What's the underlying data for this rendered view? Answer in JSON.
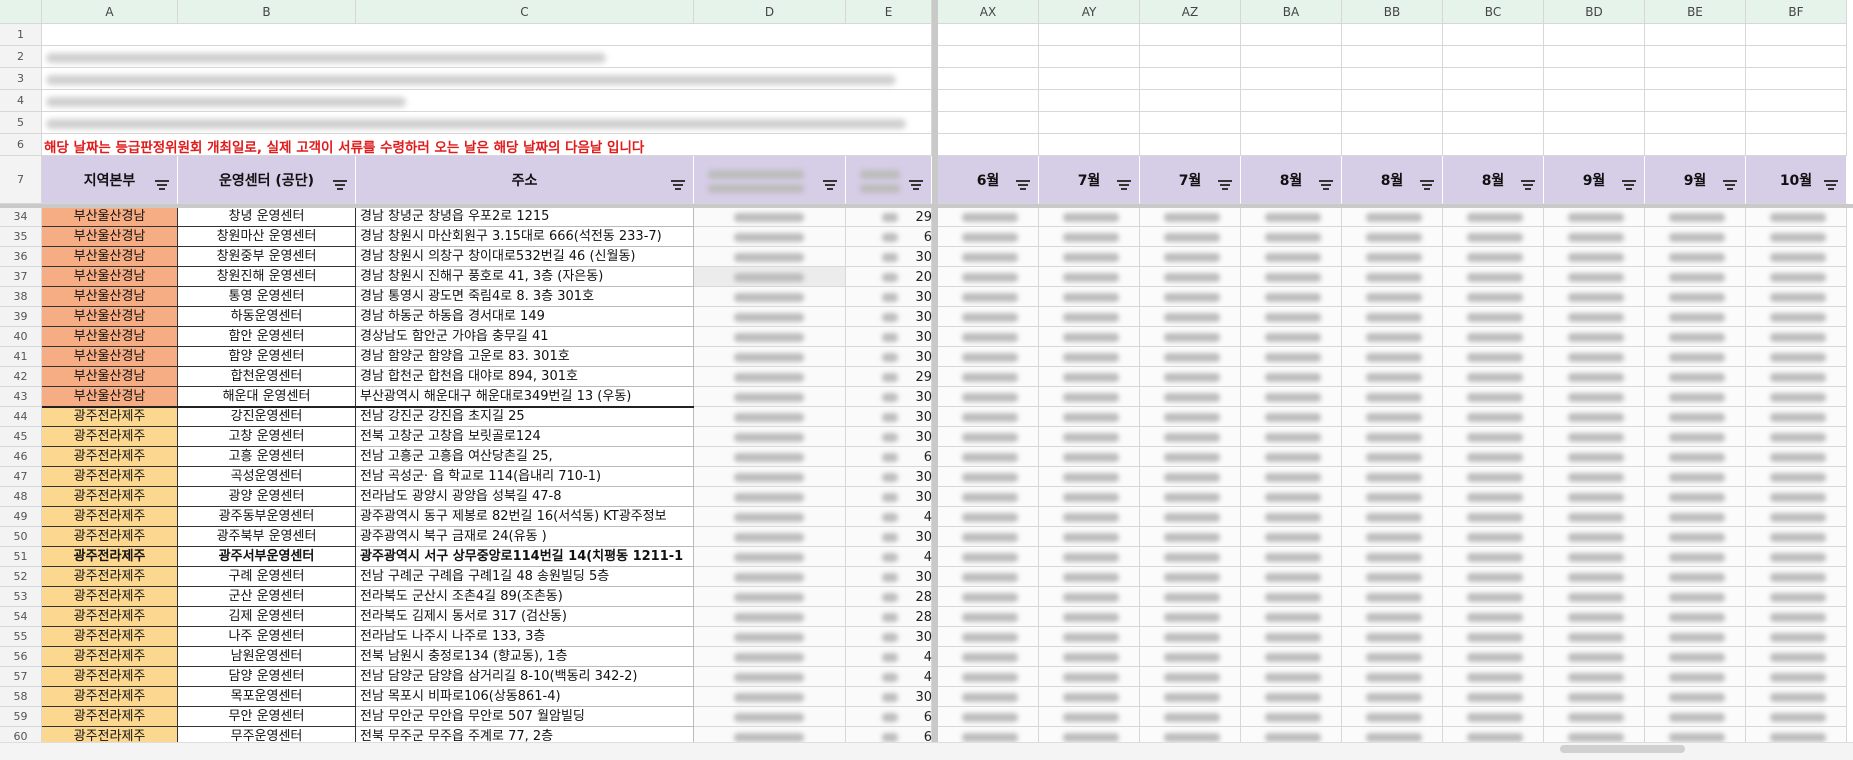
{
  "sheet": {
    "columns_left": [
      "A",
      "B",
      "C",
      "D",
      "E"
    ],
    "columns_right": [
      "AX",
      "AY",
      "AZ",
      "BA",
      "BB",
      "BC",
      "BD",
      "BE",
      "BF"
    ],
    "top_rows": [
      "1",
      "2",
      "3",
      "4",
      "5",
      "6"
    ],
    "notice_text": "해당 날짜는 등급판정위원회 개최일로, 실제 고객이 서류를 수령하러 오는 날은 해당 날짜의 다음날 입니다",
    "header_row_num": "7",
    "headers_left": [
      "지역본부",
      "운영센터 (공단)",
      "주소"
    ],
    "headers_right": [
      "6월",
      "7월",
      "7월",
      "8월",
      "8월",
      "8월",
      "9월",
      "9월",
      "10월"
    ],
    "rows": [
      {
        "num": "34",
        "region": "부산울산경남",
        "center": "창녕 운영센터",
        "address": "경남 창녕군 창녕읍 우포2로 1215",
        "edge": "29",
        "type": "busan"
      },
      {
        "num": "35",
        "region": "부산울산경남",
        "center": "창원마산 운영센터",
        "address": "경남 창원시 마산회원구 3.15대로 666(석전동 233-7)",
        "edge": "6",
        "type": "busan"
      },
      {
        "num": "36",
        "region": "부산울산경남",
        "center": "창원중부 운영센터",
        "address": "경남 창원시 의창구 창이대로532번길 46 (신월동)",
        "edge": "30",
        "type": "busan"
      },
      {
        "num": "37",
        "region": "부산울산경남",
        "center": "창원진해 운영센터",
        "address": "경남 창원시 진해구 풍호로 41, 3층 (자은동)",
        "edge": "20",
        "type": "busan"
      },
      {
        "num": "38",
        "region": "부산울산경남",
        "center": "통영 운영센터",
        "address": "경남 통영시 광도면 죽림4로 8. 3층 301호",
        "edge": "30",
        "type": "busan"
      },
      {
        "num": "39",
        "region": "부산울산경남",
        "center": "하동운영센터",
        "address": "경남 하동군 하동읍 경서대로 149",
        "edge": "30",
        "type": "busan"
      },
      {
        "num": "40",
        "region": "부산울산경남",
        "center": "함안 운영센터",
        "address": "경상남도 함안군 가야읍 충무길 41",
        "edge": "30",
        "type": "busan"
      },
      {
        "num": "41",
        "region": "부산울산경남",
        "center": "함양 운영센터",
        "address": "경남 함양군 함양읍 고운로 83. 301호",
        "edge": "30",
        "type": "busan"
      },
      {
        "num": "42",
        "region": "부산울산경남",
        "center": "합천운영센터",
        "address": "경남 합천군 합천읍 대야로 894, 301호",
        "edge": "29",
        "type": "busan"
      },
      {
        "num": "43",
        "region": "부산울산경남",
        "center": "해운대 운영센터",
        "address": "부산광역시 해운대구 해운대로349번길 13 (우동)",
        "edge": "30",
        "type": "busan"
      },
      {
        "num": "44",
        "region": "광주전라제주",
        "center": "강진운영센터",
        "address": "전남 강진군 강진읍 초지길 25",
        "edge": "30",
        "type": "gwangju"
      },
      {
        "num": "45",
        "region": "광주전라제주",
        "center": "고창 운영센터",
        "address": "전북 고창군 고창읍 보릿골로124",
        "edge": "30",
        "type": "gwangju"
      },
      {
        "num": "46",
        "region": "광주전라제주",
        "center": "고흥 운영센터",
        "address": "전남 고흥군 고흥읍 여산당촌길 25,",
        "edge": "6",
        "type": "gwangju"
      },
      {
        "num": "47",
        "region": "광주전라제주",
        "center": "곡성운영센터",
        "address": "전남 곡성군· 읍 학교로 114(읍내리 710-1)",
        "edge": "30",
        "type": "gwangju"
      },
      {
        "num": "48",
        "region": "광주전라제주",
        "center": "광양 운영센터",
        "address": "전라남도 광양시 광양읍 성북길 47-8",
        "edge": "30",
        "type": "gwangju"
      },
      {
        "num": "49",
        "region": "광주전라제주",
        "center": "광주동부운영센터",
        "address": "광주광역시 동구 제봉로 82번길 16(서석동) KT광주정보",
        "edge": "4",
        "type": "gwangju"
      },
      {
        "num": "50",
        "region": "광주전라제주",
        "center": "광주북부 운영센터",
        "address": "광주광역시 북구 금재로 24(유동 )",
        "edge": "30",
        "type": "gwangju"
      },
      {
        "num": "51",
        "region": "광주전라제주",
        "center": "광주서부운영센터",
        "address": "광주광역시 서구 상무중앙로114번길 14(치평동 1211-1",
        "edge": "4",
        "type": "gwangju",
        "bold": true
      },
      {
        "num": "52",
        "region": "광주전라제주",
        "center": "구례 운영센터",
        "address": "전남 구례군 구례읍 구례1길 48  송원빌딩 5층",
        "edge": "30",
        "type": "gwangju"
      },
      {
        "num": "53",
        "region": "광주전라제주",
        "center": "군산 운영센터",
        "address": "전라북도 군산시 조촌4길 89(조촌동)",
        "edge": "28",
        "type": "gwangju"
      },
      {
        "num": "54",
        "region": "광주전라제주",
        "center": "김제 운영센터",
        "address": "전라북도 김제시 동서로 317 (검산동)",
        "edge": "28",
        "type": "gwangju"
      },
      {
        "num": "55",
        "region": "광주전라제주",
        "center": "나주 운영센터",
        "address": "전라남도 나주시 나주로 133, 3층",
        "edge": "30",
        "type": "gwangju"
      },
      {
        "num": "56",
        "region": "광주전라제주",
        "center": "남원운영센터",
        "address": "전북 남원시 충정로134 (향교동), 1층",
        "edge": "4",
        "type": "gwangju"
      },
      {
        "num": "57",
        "region": "광주전라제주",
        "center": "담양 운영센터",
        "address": "전남 담양군 담양읍 삼거리길 8-10(백동리 342-2)",
        "edge": "4",
        "type": "gwangju"
      },
      {
        "num": "58",
        "region": "광주전라제주",
        "center": "목포운영센터",
        "address": "전남 목포시  비파로106(상동861-4)",
        "edge": "30",
        "type": "gwangju"
      },
      {
        "num": "59",
        "region": "광주전라제주",
        "center": "무안 운영센터",
        "address": "전남 무안군 무안읍 무안로 507 월암빌딩",
        "edge": "6",
        "type": "gwangju"
      },
      {
        "num": "60",
        "region": "광주전라제주",
        "center": "무주운영센터",
        "address": "전북 무주군 무주읍 주계로 77, 2층",
        "edge": "6",
        "type": "gwangju"
      }
    ]
  },
  "colors": {
    "column_header_bg": "#e6f3ea",
    "header_row_bg": "#d6cde6",
    "region_busan_bg": "#f6ad84",
    "region_gwangju_bg": "#fbd790",
    "notice_text_color": "#e11a1a"
  },
  "icons": {
    "filter": "filter-icon"
  }
}
